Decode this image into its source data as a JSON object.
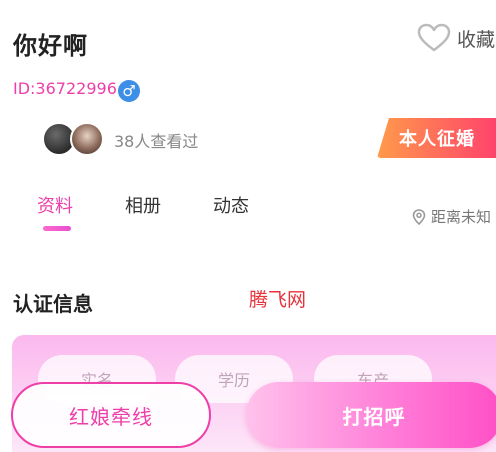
{
  "profile": {
    "name": "你好啊",
    "id_text": "ID:36722996",
    "gender_symbol": "♂",
    "favorite_label": "收藏",
    "viewers_text": "38人查看过",
    "marry_badge": "本人征婚"
  },
  "tabs": [
    {
      "label": "资料",
      "active": true
    },
    {
      "label": "相册",
      "active": false
    },
    {
      "label": "动态",
      "active": false
    }
  ],
  "distance_text": "距离未知",
  "section": {
    "title": "认证信息",
    "watermark": "腾飞网",
    "cert_items": [
      "实名",
      "学历",
      "车产"
    ]
  },
  "actions": {
    "matchmaker_label": "红娘牵线",
    "greet_label": "打招呼"
  },
  "colors": {
    "accent": "#ee3fa8",
    "gender_blue": "#3d8ee6",
    "badge_orange": "#ff9a4a"
  },
  "icons": [
    "heart-outline-icon",
    "male-icon",
    "location-pin-icon"
  ]
}
